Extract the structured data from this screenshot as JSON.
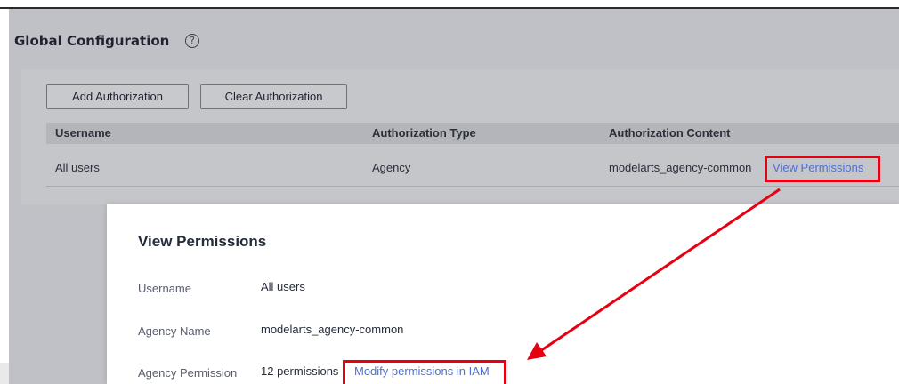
{
  "page": {
    "title": "Global Configuration",
    "help_icon": "?"
  },
  "toolbar": {
    "add_label": "Add Authorization",
    "clear_label": "Clear Authorization"
  },
  "table": {
    "columns": [
      "Username",
      "Authorization Type",
      "Authorization Content"
    ],
    "rows": [
      {
        "username": "All users",
        "type": "Agency",
        "content": "modelarts_agency-common",
        "action": "View Permissions"
      }
    ]
  },
  "modal": {
    "title": "View Permissions",
    "fields": [
      {
        "label": "Username",
        "value": "All users"
      },
      {
        "label": "Agency Name",
        "value": "modelarts_agency-common"
      },
      {
        "label": "Agency Permission",
        "value": "12 permissions",
        "link": "Modify permissions in IAM"
      }
    ]
  },
  "colors": {
    "highlight": "#e60012",
    "link": "#4f6fd1",
    "overlay": "#bfc1c6"
  }
}
